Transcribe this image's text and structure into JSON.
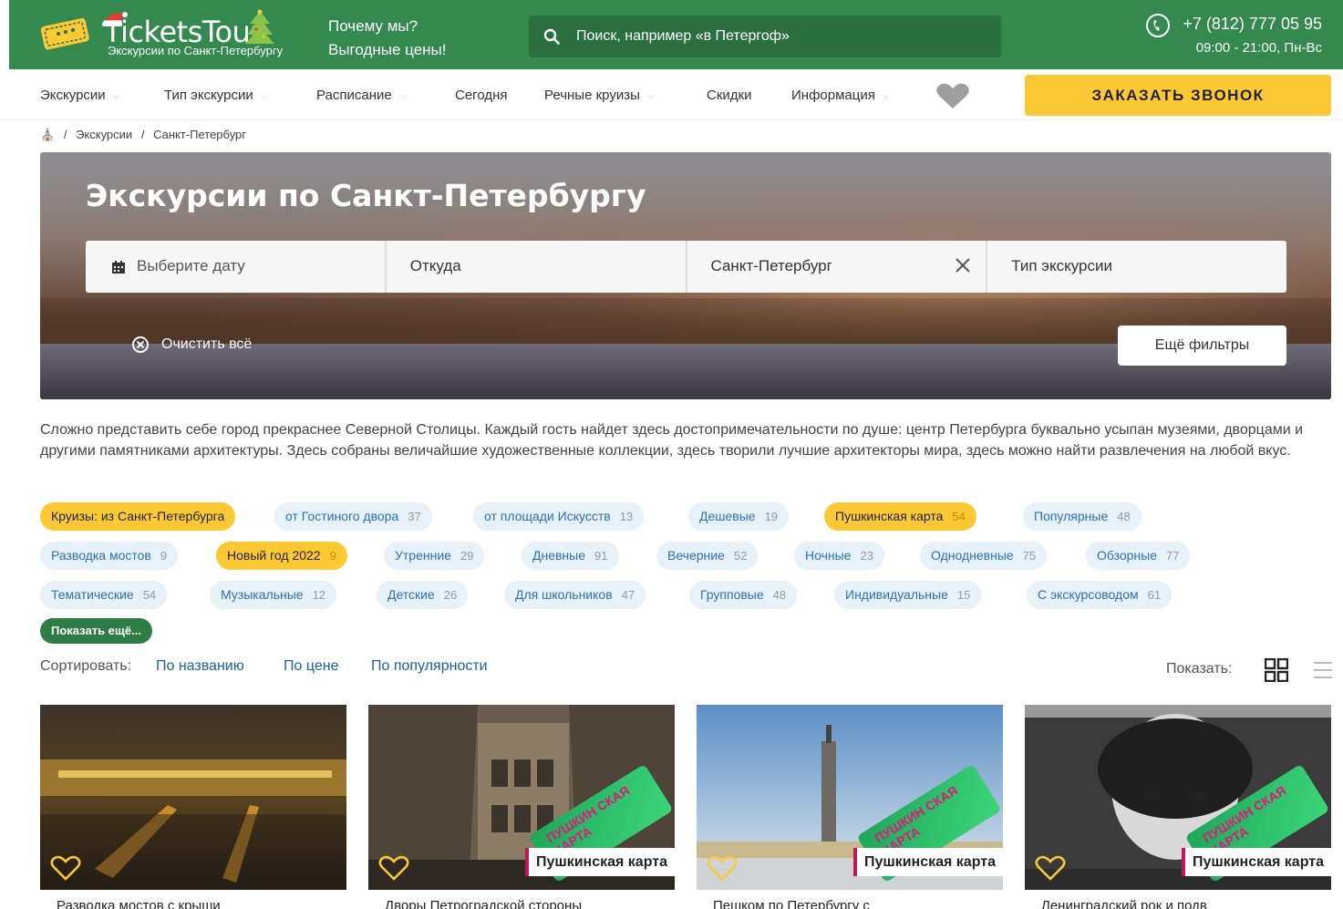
{
  "header": {
    "logo_title": "TicketsTour",
    "logo_subtitle": "Экскурсии по Санкт-Петербургу",
    "why_us": "Почему мы?",
    "good_prices": "Выгодные цены!",
    "search_placeholder": "Поиск, например «в Петергоф»",
    "phone": "+7 (812) 777 05 95",
    "hours": "09:00 - 21:00, Пн-Вс",
    "accent_color": "#34894f"
  },
  "nav": {
    "items": [
      {
        "label": "Экскурсии",
        "dropdown": true
      },
      {
        "label": "Тип экскурсии",
        "dropdown": true
      },
      {
        "label": "Расписание",
        "dropdown": true
      },
      {
        "label": "Сегодня",
        "dropdown": false
      },
      {
        "label": "Речные круизы",
        "dropdown": true
      },
      {
        "label": "Скидки",
        "dropdown": false
      },
      {
        "label": "Информация",
        "dropdown": true
      }
    ],
    "callback_label": "ЗАКАЗАТЬ ЗВОНОК"
  },
  "breadcrumb": {
    "items": [
      "Экскурсии",
      "Санкт-Петербург"
    ],
    "separator": "/"
  },
  "hero": {
    "title": "Экскурсии по Санкт-Петербургу",
    "date_placeholder": "Выберите дату",
    "from_placeholder": "Откуда",
    "city_value": "Санкт-Петербург",
    "type_placeholder": "Тип экскурсии",
    "clear_all": "Очистить всё",
    "more_filters": "Ещё фильтры"
  },
  "description": "Сложно представить себе город прекраснее Северной Столицы. Каждый гость найдет здесь достопримечательности по душе: центр Петербурга буквально усыпан музеями, дворцами и другими памятниками архитектуры. Здесь собраны величайшие художественные коллекции, здесь творили лучшие архитекторы мира, здесь можно найти развлечения на любой вкус.",
  "tags": {
    "row1": [
      {
        "label": "Круизы: из Санкт-Петербурга",
        "count": "",
        "style": "yellow"
      },
      {
        "label": "от Гостиного двора",
        "count": "37",
        "style": "blue"
      },
      {
        "label": "от площади Искусств",
        "count": "13",
        "style": "blue"
      },
      {
        "label": "Дешевые",
        "count": "19",
        "style": "blue"
      },
      {
        "label": "Пушкинская карта",
        "count": "54",
        "style": "yellow"
      },
      {
        "label": "Популярные",
        "count": "48",
        "style": "blue"
      }
    ],
    "row2": [
      {
        "label": "Разводка мостов",
        "count": "9",
        "style": "blue"
      },
      {
        "label": "Новый год 2022",
        "count": "9",
        "style": "yellow"
      },
      {
        "label": "Утренние",
        "count": "29",
        "style": "blue"
      },
      {
        "label": "Дневные",
        "count": "91",
        "style": "blue"
      },
      {
        "label": "Вечерние",
        "count": "52",
        "style": "blue"
      },
      {
        "label": "Ночные",
        "count": "23",
        "style": "blue"
      },
      {
        "label": "Однодневные",
        "count": "75",
        "style": "blue"
      },
      {
        "label": "Обзорные",
        "count": "77",
        "style": "blue"
      }
    ],
    "row3": [
      {
        "label": "Тематические",
        "count": "54",
        "style": "blue"
      },
      {
        "label": "Музыкальные",
        "count": "12",
        "style": "blue"
      },
      {
        "label": "Детские",
        "count": "26",
        "style": "blue"
      },
      {
        "label": "Для школьников",
        "count": "47",
        "style": "blue"
      },
      {
        "label": "Групповые",
        "count": "48",
        "style": "blue"
      },
      {
        "label": "Индивидуальные",
        "count": "15",
        "style": "blue"
      },
      {
        "label": "С экскурсоводом",
        "count": "61",
        "style": "blue"
      }
    ],
    "show_more": "Показать ещё..."
  },
  "sort": {
    "label": "Сортировать:",
    "by_name": "По названию",
    "by_price": "По цене",
    "by_popularity": "По популярности",
    "show_label": "Показать:"
  },
  "cards": [
    {
      "title": "Разводка мостов с крыши",
      "badge": ""
    },
    {
      "title": "Дворы Петроградской стороны",
      "badge": "Пушкинская карта"
    },
    {
      "title": "Пешком по Петербургу с",
      "badge": "Пушкинская карта"
    },
    {
      "title": "Ленинградский рок и подв",
      "badge": "Пушкинская карта"
    }
  ],
  "pushkin_card_text": "ПУШКИН СКАЯ КАРТА"
}
